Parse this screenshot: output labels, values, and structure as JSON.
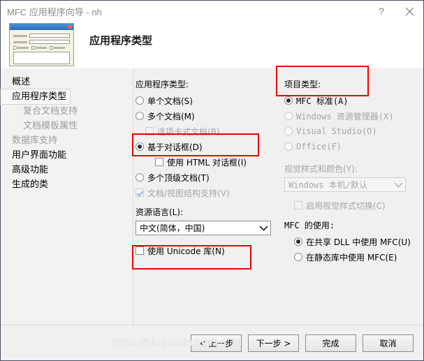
{
  "titlebar": {
    "title": "MFC 应用程序向导 - nh",
    "help_label": "?",
    "close_label": "✕"
  },
  "header": {
    "page_title": "应用程序类型"
  },
  "sidebar": {
    "items": [
      {
        "label": "概述",
        "state": "normal",
        "indent": 0
      },
      {
        "label": "应用程序类型",
        "state": "selected",
        "indent": 0
      },
      {
        "label": "复合文档支持",
        "state": "disabled",
        "indent": 1
      },
      {
        "label": "文档模板属性",
        "state": "disabled",
        "indent": 1
      },
      {
        "label": "数据库支持",
        "state": "disabled",
        "indent": 0
      },
      {
        "label": "用户界面功能",
        "state": "normal",
        "indent": 0
      },
      {
        "label": "高级功能",
        "state": "normal",
        "indent": 0
      },
      {
        "label": "生成的类",
        "state": "normal",
        "indent": 0
      }
    ]
  },
  "app_type": {
    "group_label": "应用程序类型:",
    "options": [
      {
        "label": "单个文档(S)",
        "type": "radio",
        "checked": false,
        "disabled": false,
        "indent": 0
      },
      {
        "label": "多个文档(M)",
        "type": "radio",
        "checked": false,
        "disabled": false,
        "indent": 0
      },
      {
        "label": "选项卡式文档(B)",
        "type": "checkbox",
        "checked": false,
        "disabled": true,
        "indent": 1
      },
      {
        "label": "基于对话框(D)",
        "type": "radio",
        "checked": true,
        "disabled": false,
        "indent": 0
      },
      {
        "label": "使用 HTML 对话框(I)",
        "type": "checkbox",
        "checked": false,
        "disabled": false,
        "indent": 1
      },
      {
        "label": "多个顶级文档(T)",
        "type": "radio",
        "checked": false,
        "disabled": false,
        "indent": 0
      }
    ],
    "doc_view_support": {
      "label": "文档/视图结构支持(V)",
      "checked": true,
      "disabled": true
    },
    "resource_language": {
      "label": "资源语言(L):",
      "value": "中文(简体，中国)"
    },
    "unicode": {
      "label": "使用 Unicode 库(N)",
      "checked": false
    }
  },
  "project_type": {
    "group_label": "项目类型:",
    "options": [
      {
        "label": "MFC 标准(A)",
        "checked": true,
        "disabled": false
      },
      {
        "label": "Windows 资源管理器(X)",
        "checked": false,
        "disabled": true
      },
      {
        "label": "Visual Studio(O)",
        "checked": false,
        "disabled": true
      },
      {
        "label": "Office(F)",
        "checked": false,
        "disabled": true
      }
    ],
    "visual_style": {
      "label": "视觉样式和颜色(Y):",
      "value": "Windows 本机/默认",
      "disabled": true
    },
    "enable_style_switch": {
      "label": "启用视觉样式切换(C)",
      "checked": false,
      "disabled": true
    },
    "mfc_use": {
      "group_label": "MFC 的使用:",
      "options": [
        {
          "label": "在共享 DLL 中使用 MFC(U)",
          "checked": true
        },
        {
          "label": "在静态库中使用 MFC(E)",
          "checked": false
        }
      ]
    }
  },
  "footer": {
    "buttons": [
      {
        "label": "< 上一步"
      },
      {
        "label": "下一步 >"
      },
      {
        "label": "完成"
      },
      {
        "label": "取消"
      }
    ],
    "watermark": "https://blog.csdn.net/aa_Mr"
  },
  "colors": {
    "highlight": "#ee0000",
    "title_text": "#8a8a8a",
    "window_bg": "#f0f0f0"
  }
}
